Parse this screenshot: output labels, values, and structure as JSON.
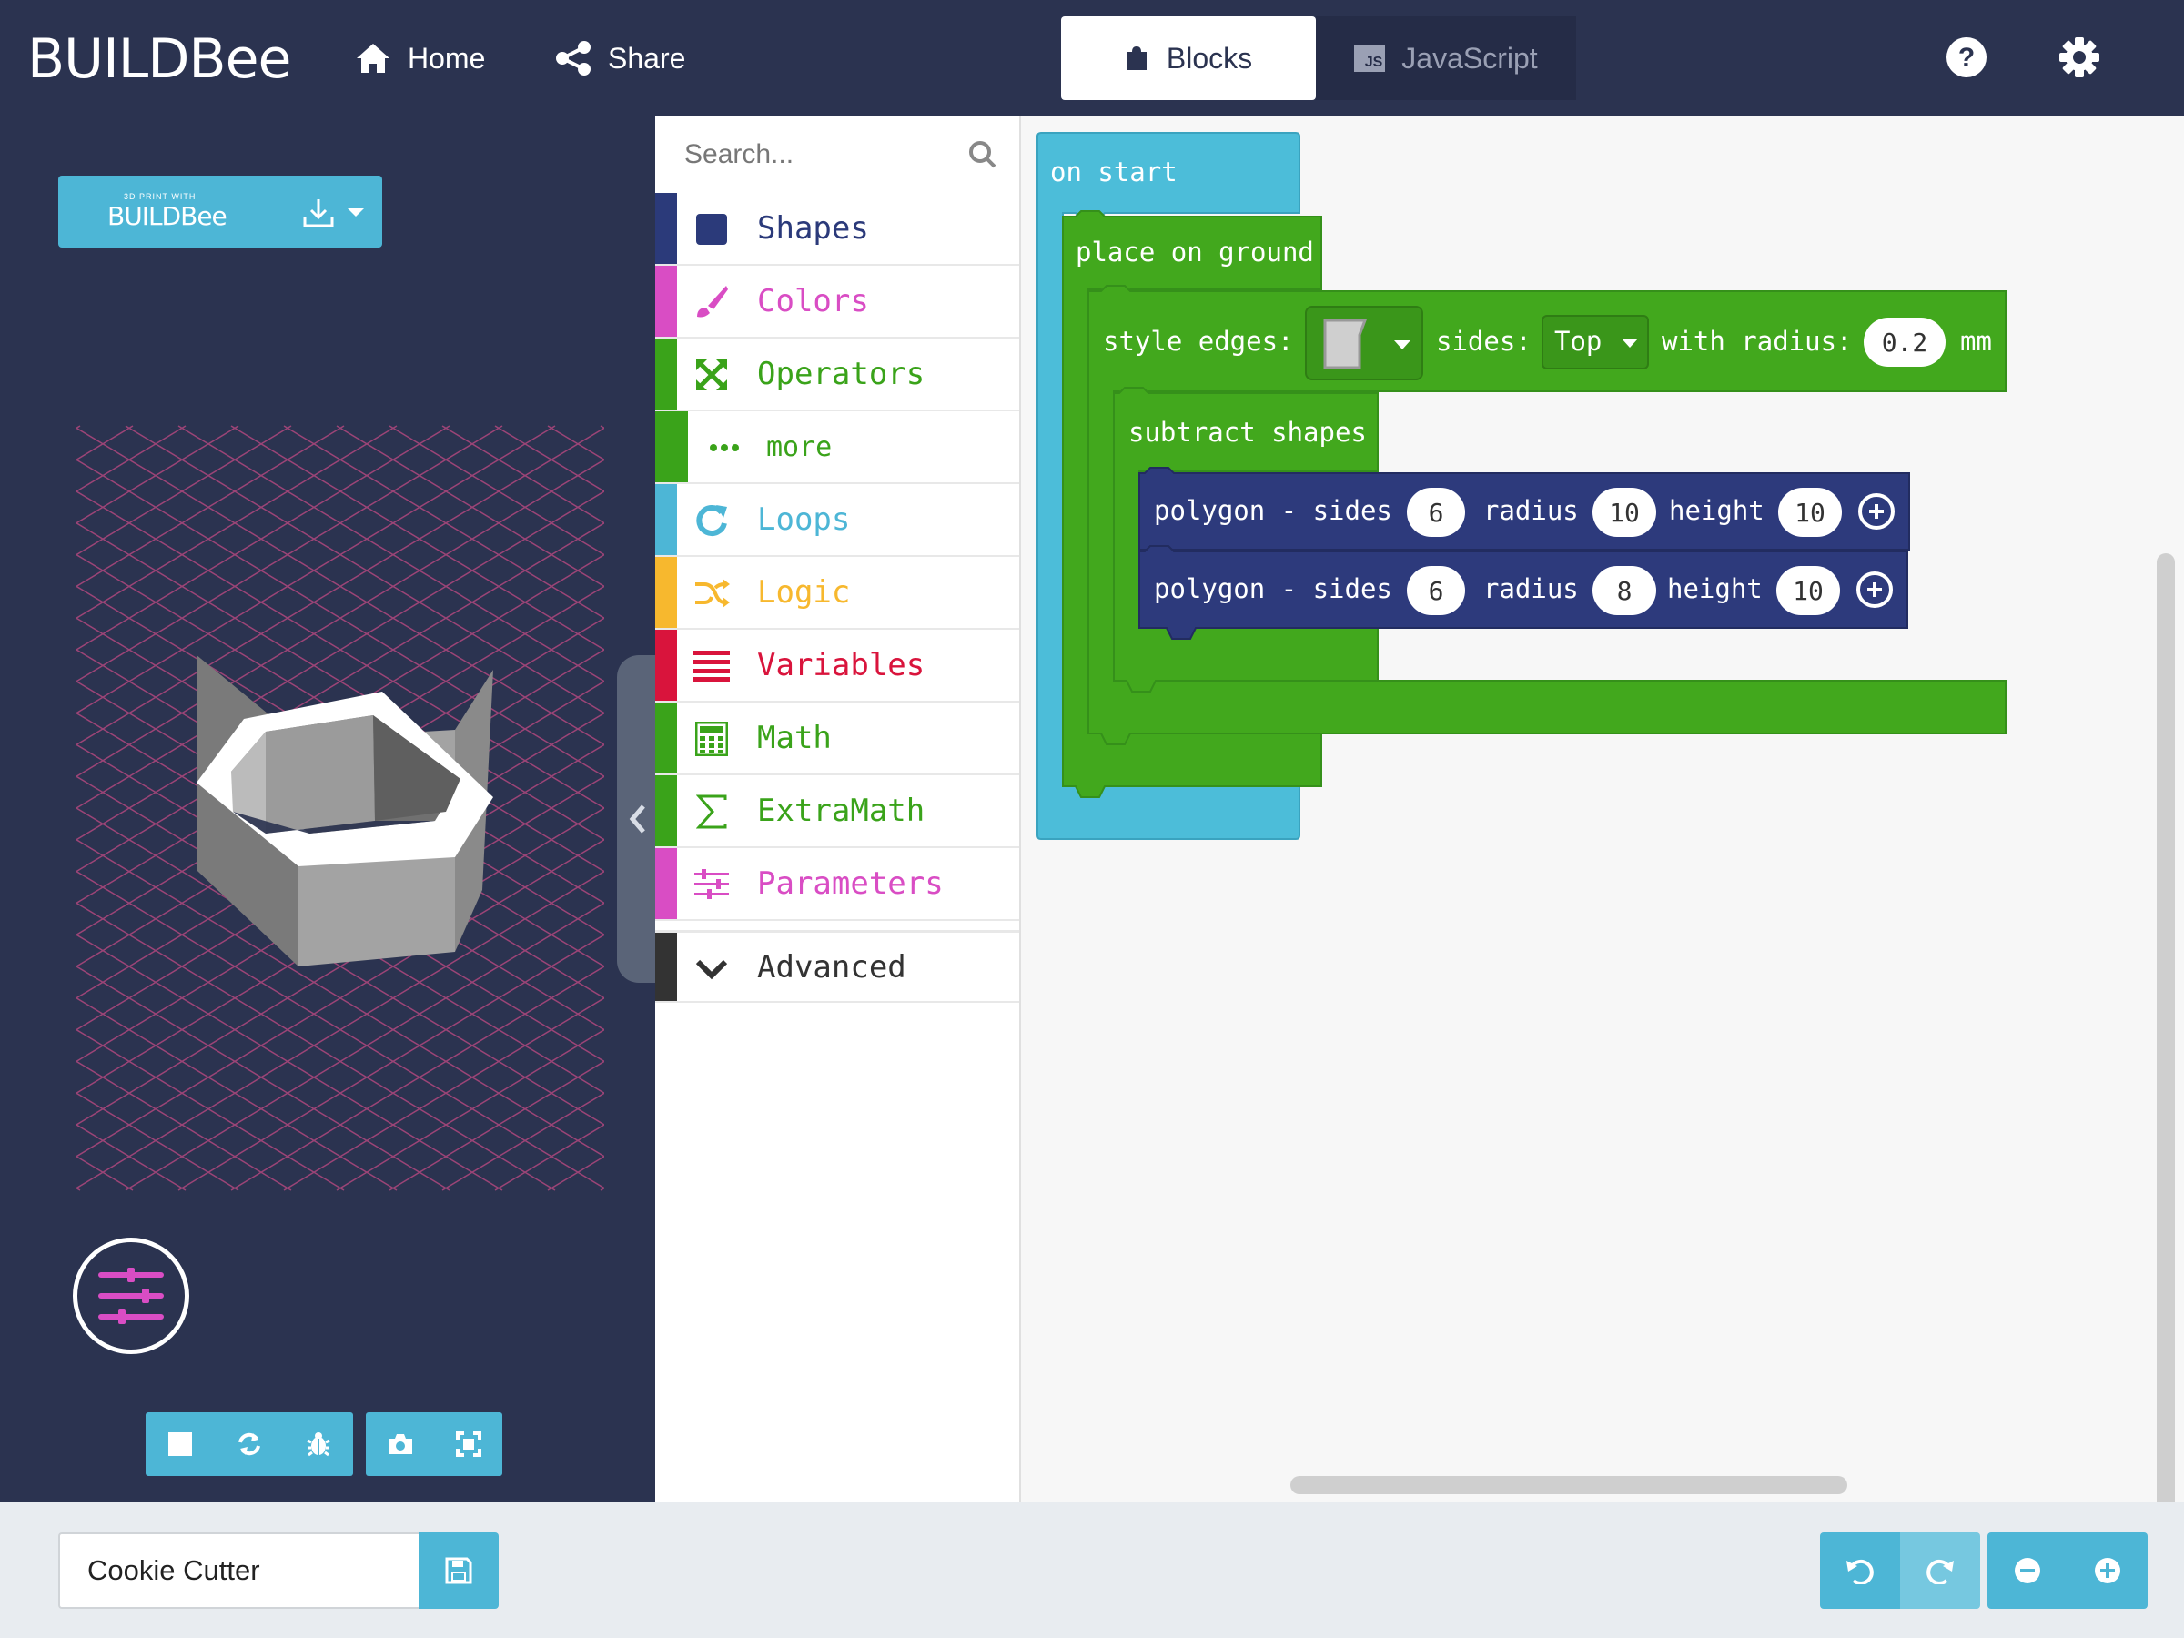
{
  "header": {
    "logo": {
      "build": "BUILD",
      "bee": "Bee"
    },
    "nav": {
      "home": "Home",
      "share": "Share"
    },
    "tabs": {
      "blocks": "Blocks",
      "javascript": "JavaScript",
      "javascript_badge": "JS"
    }
  },
  "preview": {
    "print_button": {
      "small": "3D PRINT WITH",
      "logo": "BUILDBee"
    }
  },
  "toolbox": {
    "search_placeholder": "Search...",
    "categories": [
      {
        "label": "Shapes",
        "color": "#2b3a7a",
        "icon": "square-icon"
      },
      {
        "label": "Colors",
        "color": "#d94dc4",
        "icon": "paintbrush-icon"
      },
      {
        "label": "Operators",
        "color": "#3aa31a",
        "icon": "arrows-icon"
      },
      {
        "label": "more",
        "color": "#3aa31a",
        "icon": "dots-icon"
      },
      {
        "label": "Loops",
        "color": "#4db6d6",
        "icon": "refresh-icon"
      },
      {
        "label": "Logic",
        "color": "#f7b82e",
        "icon": "shuffle-icon"
      },
      {
        "label": "Variables",
        "color": "#d9143c",
        "icon": "list-icon"
      },
      {
        "label": "Math",
        "color": "#3aa31a",
        "icon": "calculator-icon"
      },
      {
        "label": "ExtraMath",
        "color": "#3aa31a",
        "icon": "sigma-icon"
      },
      {
        "label": "Parameters",
        "color": "#d94dc4",
        "icon": "sliders-icon"
      },
      {
        "label": "Advanced",
        "color": "#333333",
        "icon": "chevron-down-icon"
      }
    ]
  },
  "workspace": {
    "on_start": "on start",
    "place_on_ground": "place on ground",
    "style_edges": {
      "label": "style edges:",
      "sides_label": "sides:",
      "sides_value": "Top",
      "radius_label": "with radius:",
      "radius_value": "0.2",
      "unit": "mm"
    },
    "subtract_shapes": "subtract shapes",
    "polygons": [
      {
        "label": "polygon - sides",
        "sides": "6",
        "radius_label": "radius",
        "radius": "10",
        "height_label": "height",
        "height": "10"
      },
      {
        "label": "polygon - sides",
        "sides": "6",
        "radius_label": "radius",
        "radius": "8",
        "height_label": "height",
        "height": "10"
      }
    ]
  },
  "footer": {
    "project_name": "Cookie Cutter"
  },
  "colors": {
    "navy": "#2b3350",
    "accent": "#4db6d6",
    "green": "#3aa31a",
    "polygon_block": "#2d3a7c"
  }
}
